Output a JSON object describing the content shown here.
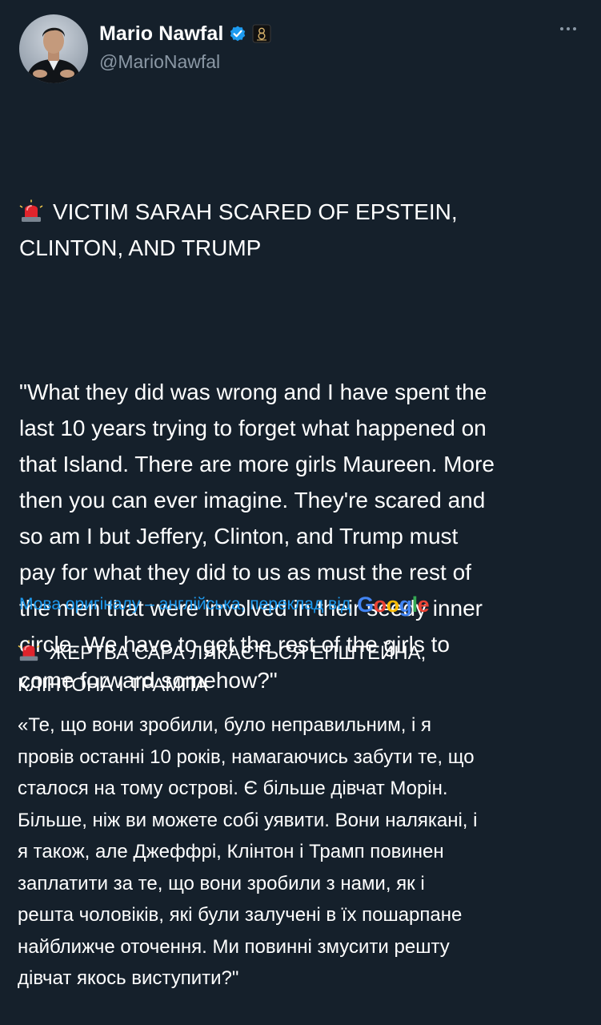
{
  "author": {
    "display_name": "Mario Nawfal",
    "handle": "@MarioNawfal",
    "verified": true,
    "avatar_icon": "avatar-photo",
    "affiliation_icon": "affiliation-badge-icon"
  },
  "menu": {
    "icon": "more-horizontal-icon"
  },
  "tweet": {
    "emoji": "police-car-light-siren-icon",
    "headline_line1": "VICTIM SARAH SCARED OF EPSTEIN,",
    "headline_line2": "CLINTON, AND TRUMP",
    "quote_lines": [
      "\"What they did was wrong and I have spent the",
      "last 10 years trying to forget what happened on",
      "that Island. There are more girls Maureen. More",
      "then you can ever imagine. They're scared and",
      "so am I but Jeffery, Clinton, and Trump must",
      "pay for what they did to us as must the rest of",
      "the men that were involved in their seedy inner",
      "circle. We have to get the rest of the girls to",
      "come forward somehow?\""
    ]
  },
  "translation": {
    "note": "Мова оригіналу – англійська, переклад від",
    "provider": "Google",
    "headline_line1": "ЖЕРТВА САРА ЛЯКАЄТЬСЯ ЕПШТЕЙНА,",
    "headline_line2": "КЛІНТОНА І ТРАМПА",
    "quote_lines": [
      "«Те, що вони зробили, було неправильним, і я",
      "провів останні 10 років, намагаючись забути те, що",
      "сталося на тому острові. Є більше дівчат Морін.",
      "Більше, ніж ви можете собі уявити. Вони налякані, і",
      "я також, але Джеффрі, Клінтон і Трамп повинен",
      "заплатити за те, що вони зробили з нами, як і",
      "решта чоловіків, які були залучені в їх пошарпане",
      "найближче оточення. Ми повинні змусити решту",
      "дівчат якось виступити?\""
    ]
  },
  "colors": {
    "background": "#15202b",
    "text_primary": "#ffffff",
    "text_secondary": "#8b98a5",
    "link": "#1d9bf0",
    "verified": "#1d9bf0"
  }
}
